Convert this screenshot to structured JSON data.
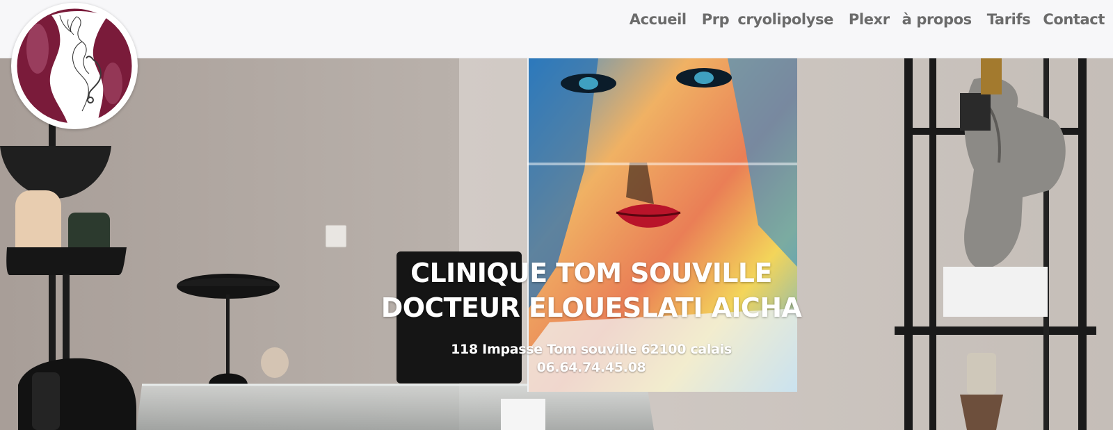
{
  "header": {
    "logo_icon": "silhouette-stethoscope-logo",
    "nav": {
      "accueil": "Accueil",
      "prp": "Prp",
      "cryolipolyse": "cryolipolyse",
      "plexr": "Plexr",
      "a_propos": "à propos",
      "tarifs": "Tarifs",
      "contact": "Contact"
    }
  },
  "hero": {
    "title_line1": "CLINIQUE TOM SOUVILLE",
    "title_line2": "DOCTEUR ELOUESLATI AICHA",
    "address": "118 Impasse Tom souville 62100 calais",
    "phone": "06.64.74.45.08"
  },
  "colors": {
    "brand_burgundy": "#7a1b3a",
    "nav_text": "#6b6b6b",
    "header_bg": "#f7f7f9",
    "hero_text": "#ffffff"
  }
}
